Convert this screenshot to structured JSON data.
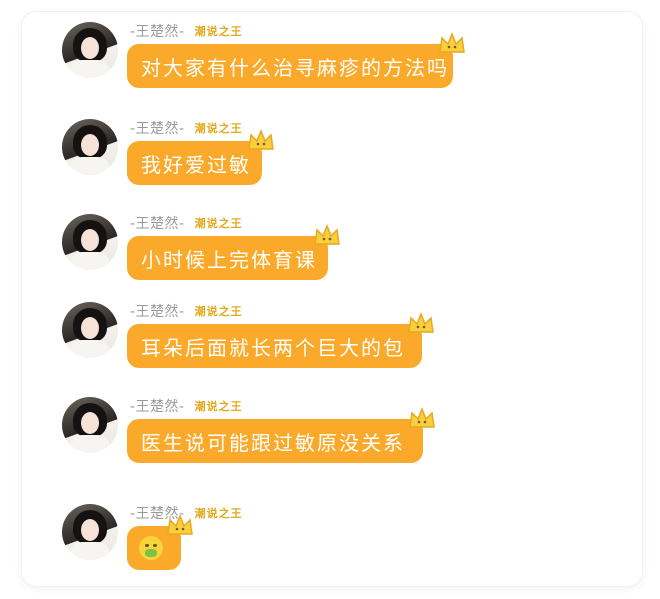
{
  "messages": [
    {
      "name": "-王楚然-",
      "badge": "潮说之王",
      "text": "对大家有什么治寻麻疹的方法吗"
    },
    {
      "name": "-王楚然-",
      "badge": "潮说之王",
      "text": "我好爱过敏"
    },
    {
      "name": "-王楚然-",
      "badge": "潮说之王",
      "text": "小时候上完体育课"
    },
    {
      "name": "-王楚然-",
      "badge": "潮说之王",
      "text": "耳朵后面就长两个巨大的包"
    },
    {
      "name": "-王楚然-",
      "badge": "潮说之王",
      "text": "医生说可能跟过敏原没关系"
    },
    {
      "name": "-王楚然-",
      "badge": "潮说之王",
      "emoji": "nauseated-face-icon"
    }
  ],
  "colors": {
    "bubble": "#fba92a",
    "badge": "#e3a81c",
    "name": "#9a9a9a"
  }
}
